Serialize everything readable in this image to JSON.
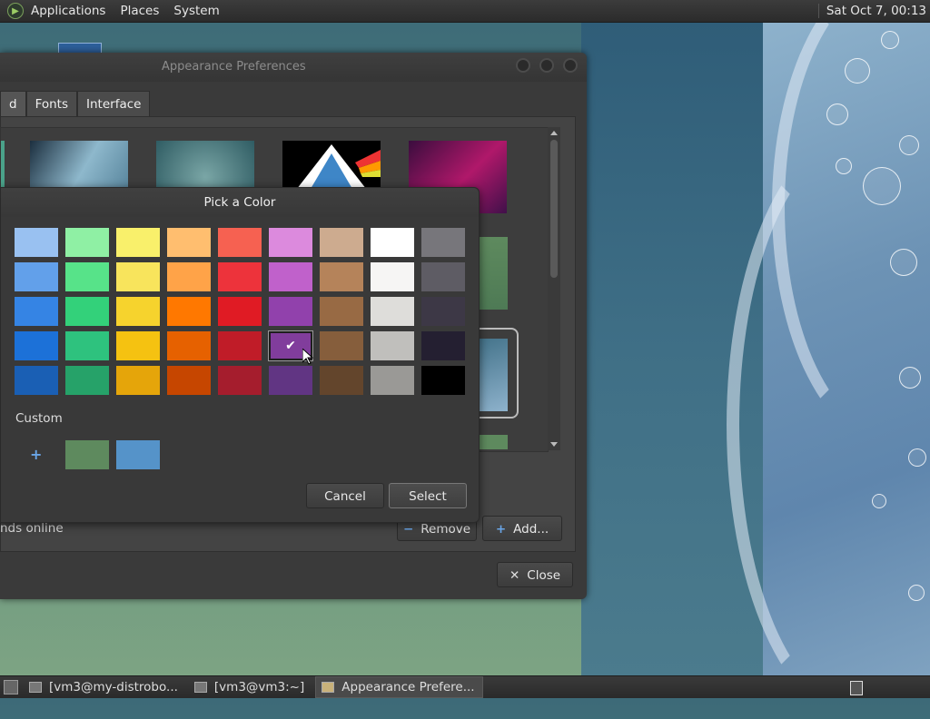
{
  "top_panel": {
    "menus": [
      "Applications",
      "Places",
      "System"
    ],
    "clock": "Sat Oct  7, 00:13"
  },
  "window": {
    "title": "Appearance Preferences",
    "tabs": [
      {
        "label": "d"
      },
      {
        "label": "Fonts"
      },
      {
        "label": "Interface"
      }
    ],
    "online_label": "nds online",
    "remove_label": "Remove",
    "add_label": "Add...",
    "close_label": "Close"
  },
  "color_dialog": {
    "title": "Pick a Color",
    "palette": [
      [
        "#99c1f1",
        "#8ff0a4",
        "#f9f06b",
        "#ffbe6f",
        "#f66151",
        "#dc8add",
        "#cdab8f",
        "#ffffff",
        "#77767b"
      ],
      [
        "#62a0ea",
        "#57e389",
        "#f8e45c",
        "#ffa348",
        "#ed333b",
        "#c061cb",
        "#b5835a",
        "#f6f5f4",
        "#5e5c64"
      ],
      [
        "#3584e4",
        "#33d17a",
        "#f6d32d",
        "#ff7800",
        "#e01b24",
        "#9141ac",
        "#986a44",
        "#deddda",
        "#3d3846"
      ],
      [
        "#1c71d8",
        "#2ec27e",
        "#f5c211",
        "#e66100",
        "#c01c28",
        "#813d9c",
        "#865e3c",
        "#c0bfbc",
        "#241f31"
      ],
      [
        "#1a5fb4",
        "#26a269",
        "#e5a50a",
        "#c64600",
        "#a51d2d",
        "#613583",
        "#63452c",
        "#9a9996",
        "#000000"
      ]
    ],
    "selected": {
      "row": 3,
      "col": 5
    },
    "custom_label": "Custom",
    "custom_colors": [
      "#5e8a5e",
      "#5593c9"
    ],
    "cancel_label": "Cancel",
    "select_label": "Select"
  },
  "taskbar": {
    "tasks": [
      {
        "label": "[vm3@my-distrobo..."
      },
      {
        "label": "[vm3@vm3:~]"
      },
      {
        "label": "Appearance Prefere...",
        "active": true
      }
    ]
  }
}
